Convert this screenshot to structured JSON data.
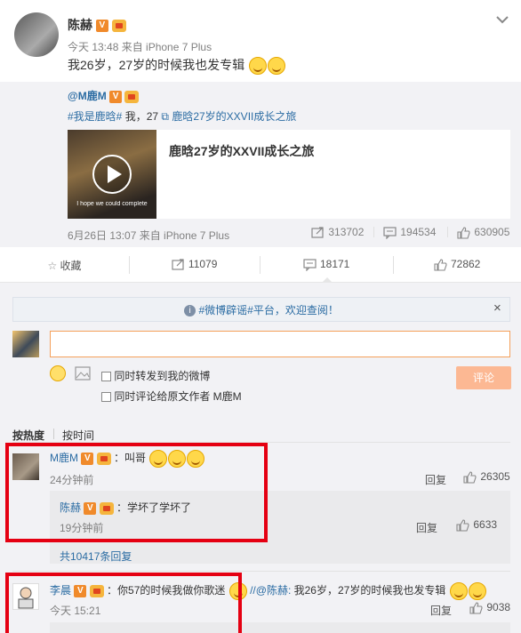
{
  "post": {
    "author": "陈赫",
    "meta": "今天 13:48 来自 iPhone 7 Plus",
    "text": "我26岁，27岁的时候我也发专辑"
  },
  "repost": {
    "author": "@M鹿M",
    "hashtag1": "#我是鹿晗#",
    "text_mid": "我，27",
    "link_text": "鹿晗27岁的XXVII成长之旅",
    "card_title": "鹿晗27岁的XXVII成长之旅",
    "video_caption": "I hope we could complete",
    "meta": "6月26日 13:07 来自 iPhone 7 Plus",
    "reposts": "313702",
    "comments": "194534",
    "likes": "630905"
  },
  "actions": {
    "favorite": "收藏",
    "reposts": "11079",
    "comments": "18171",
    "likes": "72862"
  },
  "notice": {
    "text": "#微博辟谣#平台，欢迎查阅！",
    "close": "×"
  },
  "composer": {
    "placeholder": "",
    "check1": "同时转发到我的微博",
    "check2": "同时评论给原文作者 M鹿M",
    "submit": "评论"
  },
  "sort": {
    "hot": "按热度",
    "time": "按时间"
  },
  "comments": [
    {
      "user": "M鹿M",
      "text": "：叫哥",
      "time": "24分钟前",
      "reply": "回复",
      "likes": "26305",
      "subreply": {
        "user": "陈赫",
        "text": "：学坏了学坏了",
        "time": "19分钟前",
        "reply": "回复",
        "likes": "6633"
      },
      "more": "共10417条回复"
    },
    {
      "user": "李晨",
      "text": "：你57的时候我做你歌迷",
      "mention": "//@陈赫:",
      "quote": "我26岁，27岁的时候我也发专辑",
      "time": "今天 15:21",
      "reply": "回复",
      "likes": "9038"
    }
  ]
}
